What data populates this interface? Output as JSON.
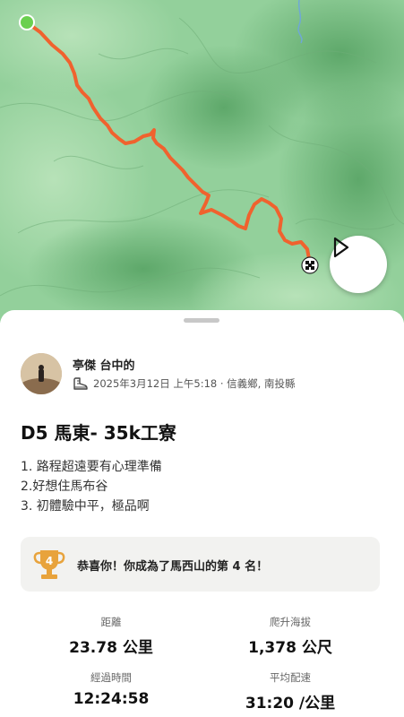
{
  "map": {
    "play_icon": "play-icon",
    "start_color": "#6ad04f",
    "route_color": "#f0622e"
  },
  "activity": {
    "athlete_name": "亭傑 台中的",
    "activity_icon": "hiking-boot-icon",
    "date_location": "2025年3月12日 上午5:18 · 信義鄉, 南投縣",
    "title": "D5 馬東- 35k工寮",
    "description": [
      "1. 路程超遠要有心理準備",
      "2.好想住馬布谷",
      "3. 初體驗中平，極品啊"
    ]
  },
  "achievement": {
    "rank": "4",
    "text": "恭喜你！你成為了馬西山的第 4 名！",
    "trophy_color": "#e8a33c"
  },
  "stats": [
    {
      "label": "距離",
      "value": "23.78 公里"
    },
    {
      "label": "爬升海拔",
      "value": "1,378 公尺"
    },
    {
      "label": "經過時間",
      "value": "12:24:58"
    },
    {
      "label": "平均配速",
      "value": "31:20 /公里"
    }
  ]
}
